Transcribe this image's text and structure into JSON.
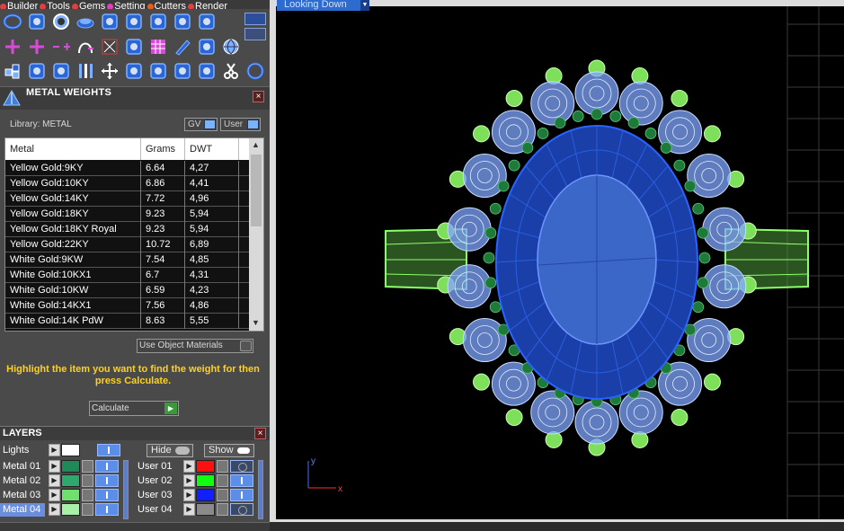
{
  "menubar": [
    {
      "label": "Builder",
      "color": "#e04040"
    },
    {
      "label": "Tools",
      "color": "#e04040"
    },
    {
      "label": "Gems",
      "color": "#e04040"
    },
    {
      "label": "Setting",
      "color": "#e040c0"
    },
    {
      "label": "Cutters",
      "color": "#e06020"
    },
    {
      "label": "Render",
      "color": "#e04040"
    }
  ],
  "toolbar_icons": {
    "row1": [
      "torus-icon",
      "helix-icon",
      "ring-icon",
      "disc-icon",
      "wave-icon",
      "cone-grid-icon",
      "frame-icon",
      "cylinder-icon",
      "tube-icon"
    ],
    "row2": [
      "plus-icon",
      "plus-icon",
      "line-plus-icon",
      "arch-plus-icon",
      "node-icon",
      "mirror-icon",
      "grid-magenta-icon",
      "pencil-icon",
      "grid-edit-icon",
      "globe-icon"
    ],
    "row3": [
      "cubes-icon",
      "curve-icon",
      "arc-icon",
      "bars-icon",
      "move-icon",
      "rotate-icon",
      "fan-icon",
      "align-icon",
      "align2-icon",
      "cut-icon",
      "circle-icon"
    ]
  },
  "metal_weights": {
    "title": "METAL WEIGHTS",
    "library_label": "Library: METAL",
    "gv_label": "GV",
    "user_label": "User",
    "columns": [
      "Metal",
      "Grams",
      "DWT"
    ],
    "rows": [
      [
        "Yellow Gold:9KY",
        "6.64",
        "4,27"
      ],
      [
        "Yellow Gold:10KY",
        "6.86",
        "4,41"
      ],
      [
        "Yellow Gold:14KY",
        "7.72",
        "4,96"
      ],
      [
        "Yellow Gold:18KY",
        "9.23",
        "5,94"
      ],
      [
        "Yellow Gold:18KY Royal",
        "9.23",
        "5,94"
      ],
      [
        "Yellow Gold:22KY",
        "10.72",
        "6,89"
      ],
      [
        "White Gold:9KW",
        "7.54",
        "4,85"
      ],
      [
        "White Gold:10KX1",
        "6.7",
        "4,31"
      ],
      [
        "White Gold:10KW",
        "6.59",
        "4,23"
      ],
      [
        "White Gold:14KX1",
        "7.56",
        "4,86"
      ],
      [
        "White Gold:14K PdW",
        "8.63",
        "5,55"
      ]
    ],
    "use_object_materials": "Use Object Materials",
    "hint": "Highlight the item you want to find the weight for then press Calculate.",
    "calculate": "Calculate"
  },
  "layers": {
    "title": "LAYERS",
    "lights_label": "Lights",
    "hide_label": "Hide",
    "show_label": "Show",
    "left": [
      {
        "name": "Metal 01",
        "color": "#1e8a5a",
        "selected": false,
        "visible": true
      },
      {
        "name": "Metal 02",
        "color": "#2fa870",
        "selected": false,
        "visible": true
      },
      {
        "name": "Metal 03",
        "color": "#6ee06e",
        "selected": false,
        "visible": true
      },
      {
        "name": "Metal 04",
        "color": "#a8f0a8",
        "selected": true,
        "visible": true
      }
    ],
    "right": [
      {
        "name": "User 01",
        "color": "#ff1010",
        "visible": false
      },
      {
        "name": "User 02",
        "color": "#10ff10",
        "visible": true
      },
      {
        "name": "User 03",
        "color": "#1020ff",
        "visible": true
      },
      {
        "name": "User 04",
        "color": "#8a8a8a",
        "visible": false
      }
    ]
  },
  "viewport": {
    "view_label": "Looking Down",
    "axis_x": "x",
    "axis_y": "y"
  }
}
